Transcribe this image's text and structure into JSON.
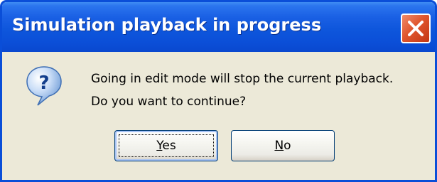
{
  "dialog": {
    "title": "Simulation playback in progress",
    "close_icon": "close-icon",
    "message_icon": "question-icon",
    "message_lines": [
      "Going in edit mode will stop the current playback.",
      "Do you want to continue?"
    ],
    "buttons": {
      "yes": {
        "mnemonic": "Y",
        "rest": "es",
        "focused": true
      },
      "no": {
        "mnemonic": "N",
        "rest": "o",
        "focused": false
      }
    }
  },
  "colors": {
    "titlebar": "#0A4ED8",
    "body": "#ECE9D8",
    "close_button": "#E0562E",
    "button_border": "#003C74"
  }
}
